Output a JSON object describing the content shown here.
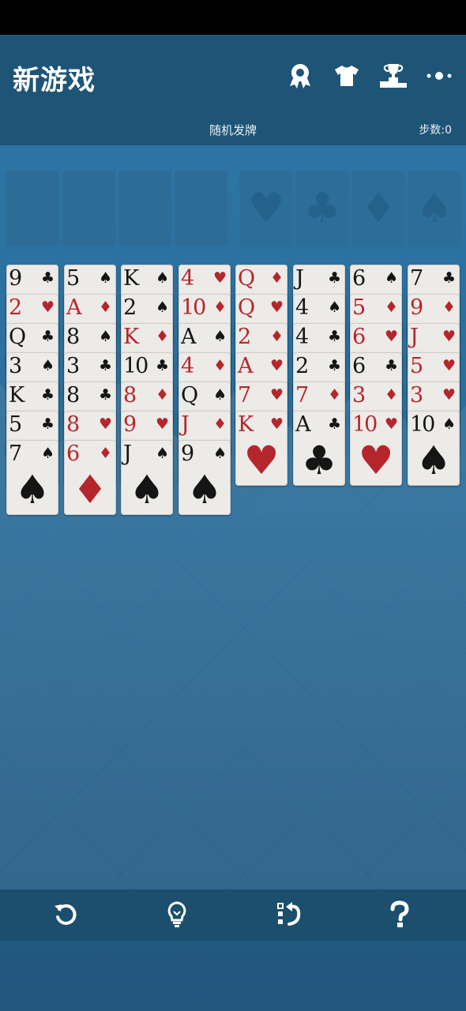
{
  "header": {
    "title": "新游戏",
    "subtitle": "随机发牌",
    "moves": "步数:0",
    "icons": [
      "badge-icon",
      "shirt-icon",
      "trophy-icon",
      "more-icon"
    ]
  },
  "foundations": [
    "♥",
    "♣",
    "♦",
    "♠"
  ],
  "columns": [
    [
      {
        "r": "9",
        "s": "♣"
      },
      {
        "r": "2",
        "s": "♥"
      },
      {
        "r": "Q",
        "s": "♣"
      },
      {
        "r": "3",
        "s": "♠"
      },
      {
        "r": "K",
        "s": "♣"
      },
      {
        "r": "5",
        "s": "♣"
      },
      {
        "r": "7",
        "s": "♠"
      }
    ],
    [
      {
        "r": "5",
        "s": "♠"
      },
      {
        "r": "A",
        "s": "♦"
      },
      {
        "r": "8",
        "s": "♠"
      },
      {
        "r": "3",
        "s": "♣"
      },
      {
        "r": "8",
        "s": "♣"
      },
      {
        "r": "8",
        "s": "♥"
      },
      {
        "r": "6",
        "s": "♦"
      }
    ],
    [
      {
        "r": "K",
        "s": "♠"
      },
      {
        "r": "2",
        "s": "♠"
      },
      {
        "r": "K",
        "s": "♦"
      },
      {
        "r": "10",
        "s": "♣"
      },
      {
        "r": "8",
        "s": "♦"
      },
      {
        "r": "9",
        "s": "♥"
      },
      {
        "r": "J",
        "s": "♠"
      }
    ],
    [
      {
        "r": "4",
        "s": "♥"
      },
      {
        "r": "10",
        "s": "♦"
      },
      {
        "r": "A",
        "s": "♠"
      },
      {
        "r": "4",
        "s": "♦"
      },
      {
        "r": "Q",
        "s": "♠"
      },
      {
        "r": "J",
        "s": "♦"
      },
      {
        "r": "9",
        "s": "♠"
      }
    ],
    [
      {
        "r": "Q",
        "s": "♦"
      },
      {
        "r": "Q",
        "s": "♥"
      },
      {
        "r": "2",
        "s": "♦"
      },
      {
        "r": "A",
        "s": "♥"
      },
      {
        "r": "7",
        "s": "♥"
      },
      {
        "r": "K",
        "s": "♥"
      }
    ],
    [
      {
        "r": "J",
        "s": "♣"
      },
      {
        "r": "4",
        "s": "♠"
      },
      {
        "r": "4",
        "s": "♣"
      },
      {
        "r": "2",
        "s": "♣"
      },
      {
        "r": "7",
        "s": "♦"
      },
      {
        "r": "A",
        "s": "♣"
      }
    ],
    [
      {
        "r": "6",
        "s": "♠"
      },
      {
        "r": "5",
        "s": "♦"
      },
      {
        "r": "6",
        "s": "♥"
      },
      {
        "r": "6",
        "s": "♣"
      },
      {
        "r": "3",
        "s": "♦"
      },
      {
        "r": "10",
        "s": "♥"
      }
    ],
    [
      {
        "r": "7",
        "s": "♣"
      },
      {
        "r": "9",
        "s": "♦"
      },
      {
        "r": "J",
        "s": "♥"
      },
      {
        "r": "5",
        "s": "♥"
      },
      {
        "r": "3",
        "s": "♥"
      },
      {
        "r": "10",
        "s": "♠"
      }
    ]
  ],
  "toolbar": [
    "undo-icon",
    "hint-icon",
    "auto-arrange-icon",
    "help-icon"
  ],
  "colors": {
    "red_suit": "#b5262c",
    "black_suit": "#151515",
    "header_bg": "#1e5576",
    "felt": "#2e78a8"
  }
}
